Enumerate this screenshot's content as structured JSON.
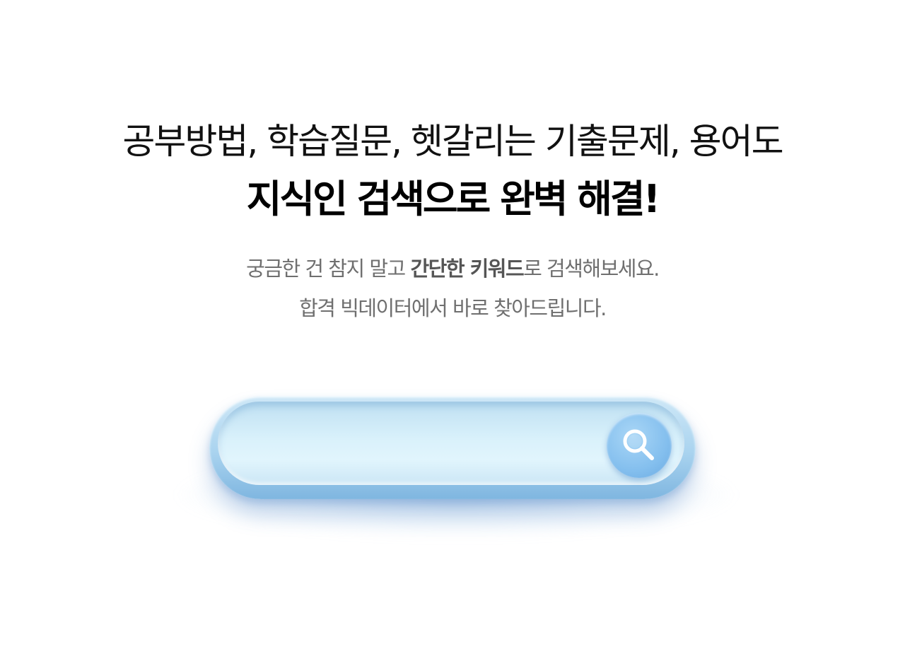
{
  "hero": {
    "line1": "공부방법, 학습질문, 헷갈리는 기출문제, 용어도",
    "line2": "지식인 검색으로 완벽 해결!",
    "sub1_prefix": "궁금한 건 참지 말고 ",
    "sub1_bold": "간단한 키워드",
    "sub1_suffix": "로 검색해보세요.",
    "sub2": "합격 빅데이터에서 바로 찾아드립니다."
  },
  "search": {
    "value": "",
    "placeholder": "",
    "button_icon": "search-icon"
  },
  "colors": {
    "bar_light": "#d9f1fb",
    "bar_dark": "#7fb6e0",
    "button": "#84bfee"
  }
}
